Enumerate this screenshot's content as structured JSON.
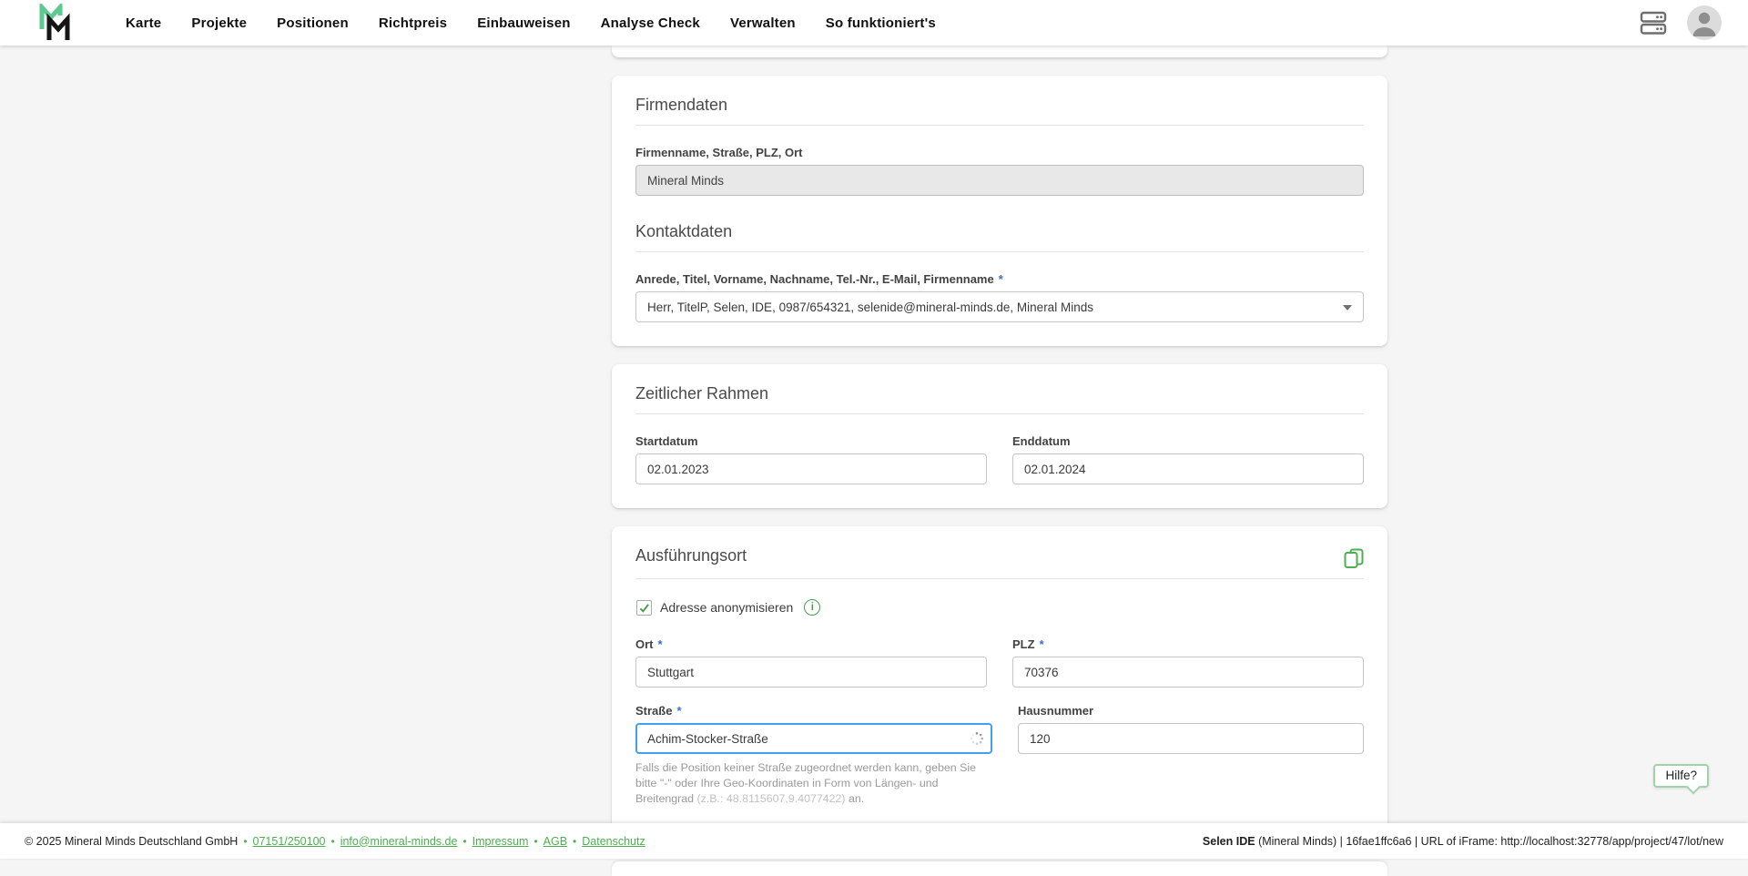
{
  "ui": {
    "required_mark": "*"
  },
  "colors": {
    "brand_green": "#5ec98e",
    "accent_green": "#4caf50",
    "focus_blue": "#41a0f0",
    "required_blue": "#3b6fc9",
    "background_gray": "#f5f5f5"
  },
  "icons": {
    "logo": "mineral-minds-logo",
    "server": "server-stack-icon",
    "avatar": "user-avatar-icon",
    "chevron": "chevron-down-icon",
    "copy": "copy-icon",
    "checkmark": "checkmark-icon",
    "info": "info-icon",
    "spinner": "loading-spinner-icon"
  },
  "header": {
    "nav": [
      "Karte",
      "Projekte",
      "Positionen",
      "Richtpreis",
      "Einbauweisen",
      "Analyse Check",
      "Verwalten",
      "So funktioniert's"
    ]
  },
  "cards": {
    "firmendaten": {
      "title": "Firmendaten",
      "company_label": "Firmenname, Straße, PLZ, Ort",
      "company_value": "Mineral Minds",
      "kontakt_title": "Kontaktdaten",
      "contact_label": "Anrede, Titel, Vorname, Nachname, Tel.-Nr., E-Mail, Firmenname",
      "contact_value": "Herr, TitelP, Selen, IDE, 0987/654321, selenide@mineral-minds.de, Mineral Minds"
    },
    "zeitlicher_rahmen": {
      "title": "Zeitlicher Rahmen",
      "start_label": "Startdatum",
      "start_value": "02.01.2023",
      "end_label": "Enddatum",
      "end_value": "02.01.2024"
    },
    "ausfuehrungsort": {
      "title": "Ausführungsort",
      "anonymize_label": "Adresse anonymisieren",
      "ort_label": "Ort",
      "ort_value": "Stuttgart",
      "plz_label": "PLZ",
      "plz_value": "70376",
      "strasse_label": "Straße",
      "strasse_value": "Achim-Stocker-Straße",
      "hausnummer_label": "Hausnummer",
      "hausnummer_value": "120",
      "helper_text_1": "Falls die Position keiner Straße zugeordnet werden kann, geben Sie bitte \"-\" oder Ihre Geo-Koordinaten in Form von Längen- und Breitengrad ",
      "helper_text_coords": "(z.B.: 48.8115607,9.4077422)",
      "helper_text_2": " an."
    }
  },
  "help_button_label": "Hilfe?",
  "footer": {
    "copyright": "© 2025 Mineral Minds Deutschland GmbH",
    "separator": "•",
    "links": [
      "07151/250100",
      "info@mineral-minds.de",
      "Impressum",
      "AGB",
      "Datenschutz"
    ],
    "right_bold": "Selen IDE",
    "right_rest": " (Mineral Minds) | 16fae1ffc6a6 | URL of iFrame: http://localhost:32778/app/project/47/lot/new"
  }
}
